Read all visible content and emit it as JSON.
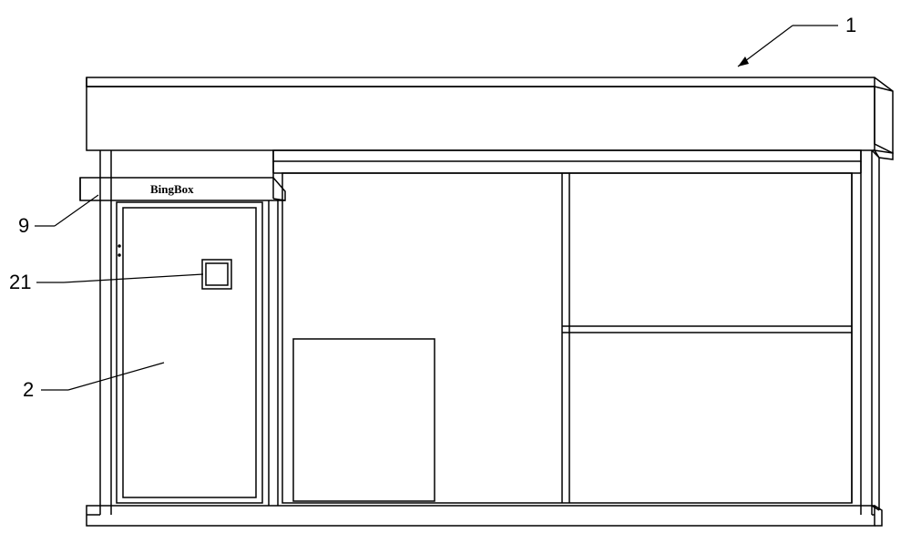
{
  "labels": {
    "ref1": "1",
    "ref9": "9",
    "ref21": "21",
    "ref2": "2"
  },
  "awning_text": "BingBox"
}
